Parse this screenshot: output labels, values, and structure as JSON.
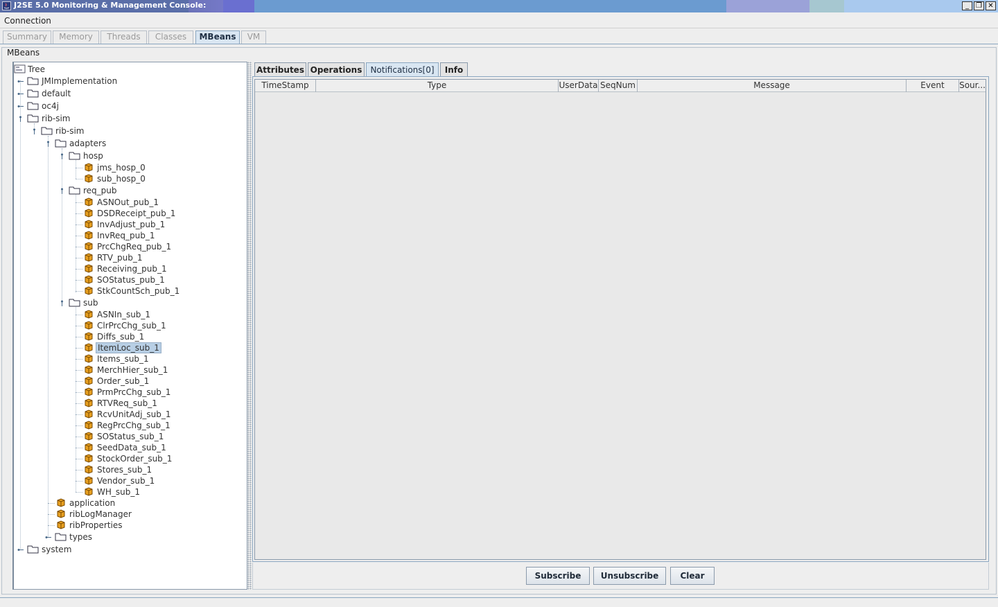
{
  "window": {
    "title": "J2SE 5.0 Monitoring & Management Console:",
    "buttons": {
      "minimize": "_",
      "restore": "❐",
      "close": "✕"
    }
  },
  "menubar": {
    "connection": "Connection"
  },
  "main_tabs": [
    {
      "label": "Summary",
      "active": false
    },
    {
      "label": "Memory",
      "active": false
    },
    {
      "label": "Threads",
      "active": false
    },
    {
      "label": "Classes",
      "active": false
    },
    {
      "label": "MBeans",
      "active": true
    },
    {
      "label": "VM",
      "active": false
    }
  ],
  "mbeans": {
    "title": "MBeans",
    "tree": {
      "root": "Tree",
      "nodes": {
        "jmimpl": "JMImplementation",
        "default": "default",
        "oc4j": "oc4j",
        "ribsim": "rib-sim",
        "ribsim2": "rib-sim",
        "adapters": "adapters",
        "hosp": "hosp",
        "jms_hosp": "jms_hosp_0",
        "sub_hosp": "sub_hosp_0",
        "req_pub": "req_pub",
        "pub_items": [
          "ASNOut_pub_1",
          "DSDReceipt_pub_1",
          "InvAdjust_pub_1",
          "InvReq_pub_1",
          "PrcChgReq_pub_1",
          "RTV_pub_1",
          "Receiving_pub_1",
          "SOStatus_pub_1",
          "StkCountSch_pub_1"
        ],
        "sub": "sub",
        "sub_items": [
          "ASNIn_sub_1",
          "ClrPrcChg_sub_1",
          "Diffs_sub_1",
          "ItemLoc_sub_1",
          "Items_sub_1",
          "MerchHier_sub_1",
          "Order_sub_1",
          "PrmPrcChg_sub_1",
          "RTVReq_sub_1",
          "RcvUnitAdj_sub_1",
          "RegPrcChg_sub_1",
          "SOStatus_sub_1",
          "SeedData_sub_1",
          "StockOrder_sub_1",
          "Stores_sub_1",
          "Vendor_sub_1",
          "WH_sub_1"
        ],
        "selected": "ItemLoc_sub_1",
        "application": "application",
        "ribLogManager": "ribLogManager",
        "ribProperties": "ribProperties",
        "types": "types",
        "system": "system"
      }
    },
    "sub_tabs": [
      {
        "label": "Attributes",
        "active": false
      },
      {
        "label": "Operations",
        "active": false
      },
      {
        "label": "Notifications[0]",
        "active": true
      },
      {
        "label": "Info",
        "active": false
      }
    ],
    "table_columns": [
      "TimeStamp",
      "Type",
      "UserData",
      "SeqNum",
      "Message",
      "Event",
      "Sour..."
    ],
    "buttons": {
      "subscribe": "Subscribe",
      "unsubscribe": "Unsubscribe",
      "clear": "Clear"
    }
  },
  "colors": {
    "accent": "#d9e6f2",
    "selection": "#b8cfe5",
    "bean_icon": "#e8a020",
    "folder": "#ffffff"
  }
}
